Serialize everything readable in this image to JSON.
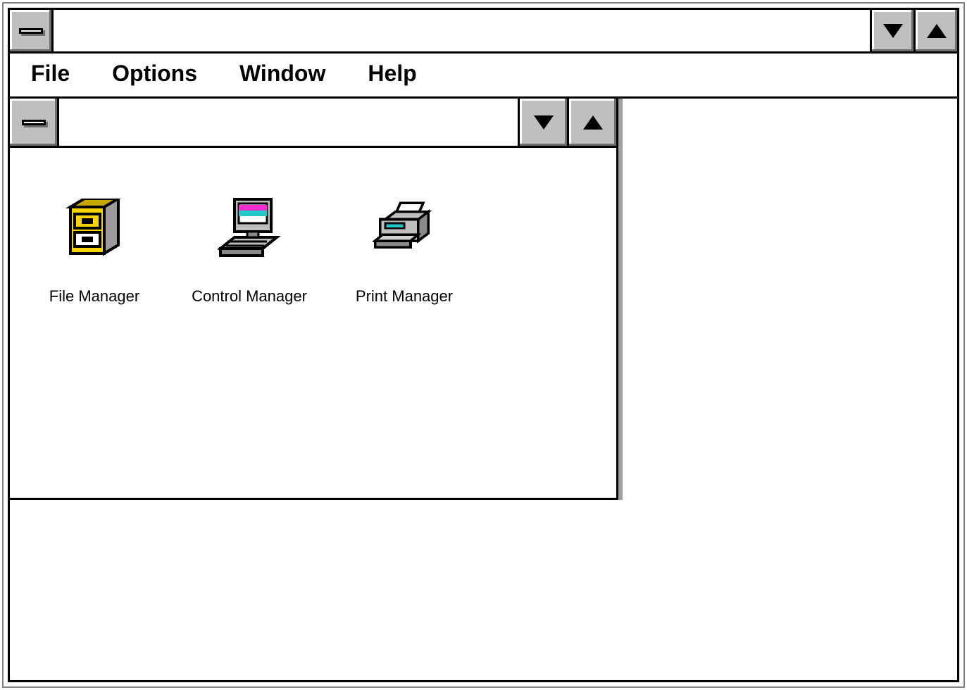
{
  "menubar": {
    "items": [
      "File",
      "Options",
      "Window",
      "Help"
    ]
  },
  "group_window": {
    "items": [
      {
        "label": "File Manager"
      },
      {
        "label": "Control Manager"
      },
      {
        "label": "Print Manager"
      }
    ]
  }
}
